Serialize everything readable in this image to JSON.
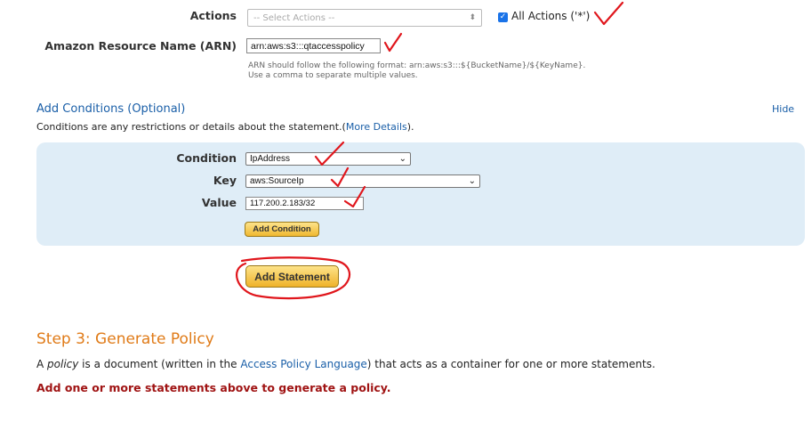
{
  "actions": {
    "label": "Actions",
    "select_placeholder": "-- Select Actions --",
    "all_actions_label": "All Actions ('*')",
    "all_actions_checked": true
  },
  "arn": {
    "label": "Amazon Resource Name (ARN)",
    "value": "arn:aws:s3:::qtaccesspolicy",
    "hint_line1": "ARN should follow the following format: arn:aws:s3:::${BucketName}/${KeyName}.",
    "hint_line2": "Use a comma to separate multiple values."
  },
  "conditions": {
    "title": "Add Conditions (Optional)",
    "hide_link": "Hide",
    "desc_prefix": "Conditions are any restrictions or details about the statement.(",
    "desc_link": "More Details",
    "desc_suffix": ").",
    "condition_label": "Condition",
    "condition_value": "IpAddress",
    "key_label": "Key",
    "key_value": "aws:SourceIp",
    "value_label": "Value",
    "value_value": "117.200.2.183/32",
    "add_condition_button": "Add Condition"
  },
  "add_statement_button": "Add Statement",
  "step3": {
    "title": "Step 3: Generate Policy",
    "desc_prefix": "A ",
    "desc_italic": "policy",
    "desc_middle": " is a document (written in the ",
    "desc_link": "Access Policy Language",
    "desc_suffix": ") that acts as a container for one or more statements.",
    "warning": "Add one or more statements above to generate a policy."
  },
  "colors": {
    "annotation_red": "#e0161c",
    "link_blue": "#1a5fa8",
    "step_orange": "#e07b18",
    "warning_red": "#a01414",
    "panel_bg": "#dfedf7"
  }
}
